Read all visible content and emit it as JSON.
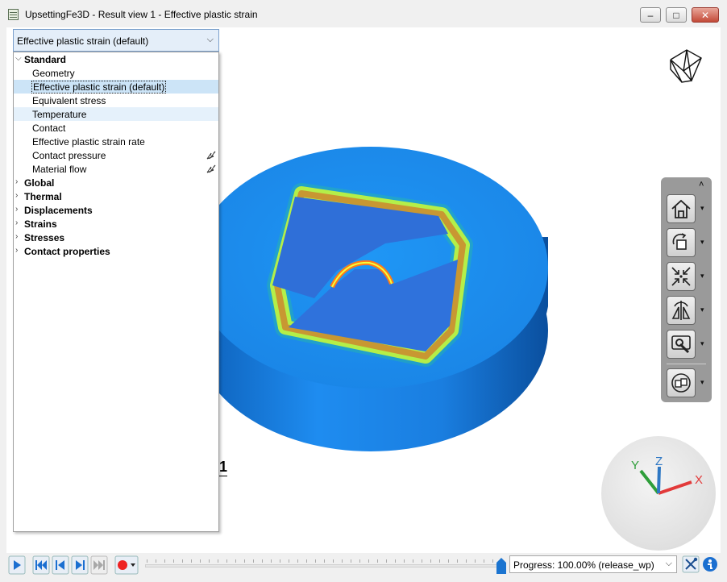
{
  "window": {
    "title": "UpsettingFe3D - Result view 1 - Effective plastic strain",
    "min_glyph": "–",
    "max_glyph": "□",
    "close_glyph": "✕"
  },
  "result_select": {
    "value": "Effective plastic strain (default)"
  },
  "tree": {
    "rows": [
      {
        "label": "Standard",
        "type": "category",
        "expanded": true
      },
      {
        "label": "Geometry",
        "type": "child"
      },
      {
        "label": "Effective plastic strain (default)",
        "type": "child",
        "state": "selected"
      },
      {
        "label": "Equivalent stress",
        "type": "child"
      },
      {
        "label": "Temperature",
        "type": "child",
        "state": "hover"
      },
      {
        "label": "Contact",
        "type": "child"
      },
      {
        "label": "Effective plastic strain rate",
        "type": "child"
      },
      {
        "label": "Contact pressure",
        "type": "child",
        "icon": "vector-arrows-icon"
      },
      {
        "label": "Material flow",
        "type": "child",
        "icon": "vector-arrows-icon"
      },
      {
        "label": "Global",
        "type": "category",
        "expanded": false
      },
      {
        "label": "Thermal",
        "type": "category",
        "expanded": false
      },
      {
        "label": "Displacements",
        "type": "category",
        "expanded": false
      },
      {
        "label": "Strains",
        "type": "category",
        "expanded": false
      },
      {
        "label": "Stresses",
        "type": "category",
        "expanded": false
      },
      {
        "label": "Contact properties",
        "type": "category",
        "expanded": false
      }
    ],
    "expanded_arrow": "⌵",
    "collapsed_arrow": "›"
  },
  "viewport": {
    "frame_label": "1"
  },
  "toolbar": {
    "collapse_glyph": "˄",
    "buttons": [
      {
        "name": "home-view-button",
        "icon": "home-icon"
      },
      {
        "name": "rotate-view-button",
        "icon": "rotate-icon"
      },
      {
        "name": "fit-view-button",
        "icon": "fit-icon"
      },
      {
        "name": "section-view-button",
        "icon": "mirror-icon"
      },
      {
        "name": "tools-button",
        "icon": "wrench-icon"
      },
      {
        "name": "view-options-button",
        "icon": "orbit-icon"
      }
    ],
    "dropdown_glyph": "▾"
  },
  "axes": {
    "x_label": "X",
    "y_label": "Y",
    "z_label": "Z",
    "x_color": "#e23a3a",
    "y_color": "#2e9e3a",
    "z_color": "#2f78c4"
  },
  "bottom": {
    "progress": 1.0,
    "progress_text": "Progress: 100.00% (release_wp)",
    "progress_chevron": "⌵"
  },
  "colors": {
    "model_base": "#1a86e8",
    "accent": "#1b74d0",
    "toolbar_bg": "#9a9a9a"
  }
}
